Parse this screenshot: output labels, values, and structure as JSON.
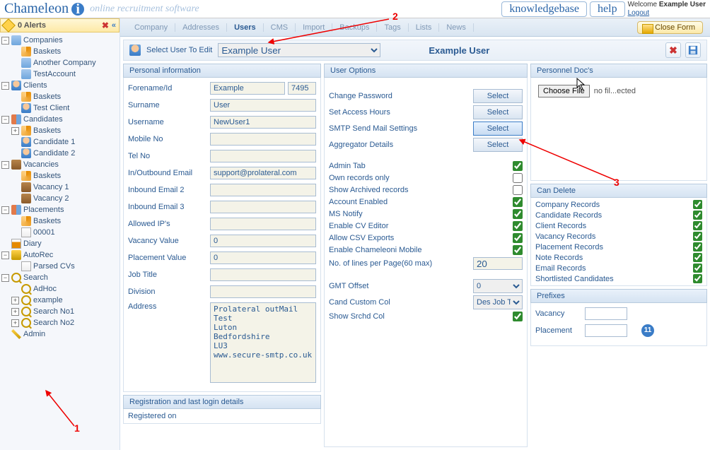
{
  "header": {
    "logo": "Chameleon",
    "tagline": "online recruitment software",
    "knowledgebase": "knowledgebase",
    "help": "help",
    "welcome_prefix": "Welcome ",
    "welcome_user": "Example User",
    "logout": "Logout"
  },
  "alerts": {
    "count": "0 Alerts"
  },
  "tree": {
    "companies": "Companies",
    "companies_baskets": "Baskets",
    "another_company": "Another Company",
    "test_account": "TestAccount",
    "clients": "Clients",
    "clients_baskets": "Baskets",
    "test_client": "Test Client",
    "candidates": "Candidates",
    "candidates_baskets": "Baskets",
    "candidate1": "Candidate 1",
    "candidate2": "Candidate 2",
    "vacancies": "Vacancies",
    "vacancies_baskets": "Baskets",
    "vacancy1": "Vacancy 1",
    "vacancy2": "Vacancy 2",
    "placements": "Placements",
    "placements_baskets": "Baskets",
    "p00001": "00001",
    "diary": "Diary",
    "autorec": "AutoRec",
    "parsed_cvs": "Parsed CVs",
    "search": "Search",
    "adhoc": "AdHoc",
    "example": "example",
    "search1": "Search No1",
    "search2": "Search No2",
    "admin": "Admin"
  },
  "tabs": {
    "company": "Company",
    "addresses": "Addresses",
    "users": "Users",
    "cms": "CMS",
    "import": "Import",
    "backups": "Backups",
    "tags": "Tags",
    "lists": "Lists",
    "news": "News",
    "close_form": "Close Form"
  },
  "editHeader": {
    "prompt": "Select User To Edit",
    "select_value": "Example User",
    "title": "Example User"
  },
  "sections": {
    "personal": "Personal information",
    "options": "User Options",
    "docs": "Personnel Doc's",
    "can_delete": "Can Delete",
    "prefixes": "Prefixes",
    "reg": "Registration and last login details"
  },
  "personal": {
    "forename_lbl": "Forename/Id",
    "forename": "Example",
    "id": "7495",
    "surname_lbl": "Surname",
    "surname": "User",
    "username_lbl": "Username",
    "username": "NewUser1",
    "mobile_lbl": "Mobile No",
    "mobile": "",
    "tel_lbl": "Tel No",
    "tel": "",
    "email_lbl": "In/Outbound Email",
    "email": "support@prolateral.com",
    "email2_lbl": "Inbound Email 2",
    "email2": "",
    "email3_lbl": "Inbound Email 3",
    "email3": "",
    "ips_lbl": "Allowed IP's",
    "ips": "",
    "vacval_lbl": "Vacancy Value",
    "vacval": "0",
    "placeval_lbl": "Placement Value",
    "placeval": "0",
    "jobtitle_lbl": "Job Title",
    "jobtitle": "",
    "division_lbl": "Division",
    "division": "",
    "address_lbl": "Address",
    "address": "Prolateral outMail Test\nLuton\nBedfordshire\nLU3\nwww.secure-smtp.co.uk",
    "reg_on_lbl": "Registered on"
  },
  "options": {
    "change_pw": "Change Password",
    "access_hours": "Set Access Hours",
    "smtp": "SMTP Send Mail Settings",
    "aggregator": "Aggregator Details",
    "select_btn": "Select",
    "admin_tab": "Admin Tab",
    "own_records": "Own records only",
    "show_archived": "Show Archived records",
    "account_enabled": "Account Enabled",
    "ms_notify": "MS Notify",
    "enable_cv": "Enable CV Editor",
    "allow_csv": "Allow CSV Exports",
    "enable_mobile": "Enable Chameleoni Mobile",
    "lines_lbl": "No. of lines per Page(60 max)",
    "lines": "20",
    "gmt_lbl": "GMT Offset",
    "gmt": "0",
    "custom_col_lbl": "Cand Custom Col",
    "custom_col": "Des Job T",
    "show_srchd": "Show Srchd Col"
  },
  "docs": {
    "choose": "Choose File",
    "nofile": "no fil...ected"
  },
  "canDelete": {
    "company": "Company Records",
    "candidate": "Candidate Records",
    "client": "Client Records",
    "vacancy": "Vacancy Records",
    "placement": "Placement Records",
    "note": "Note Records",
    "email": "Email Records",
    "shortlisted": "Shortlisted Candidates"
  },
  "prefixes": {
    "vacancy": "Vacancy",
    "placement": "Placement",
    "badge": "11"
  },
  "annotations": {
    "n1": "1",
    "n2": "2",
    "n3": "3"
  }
}
